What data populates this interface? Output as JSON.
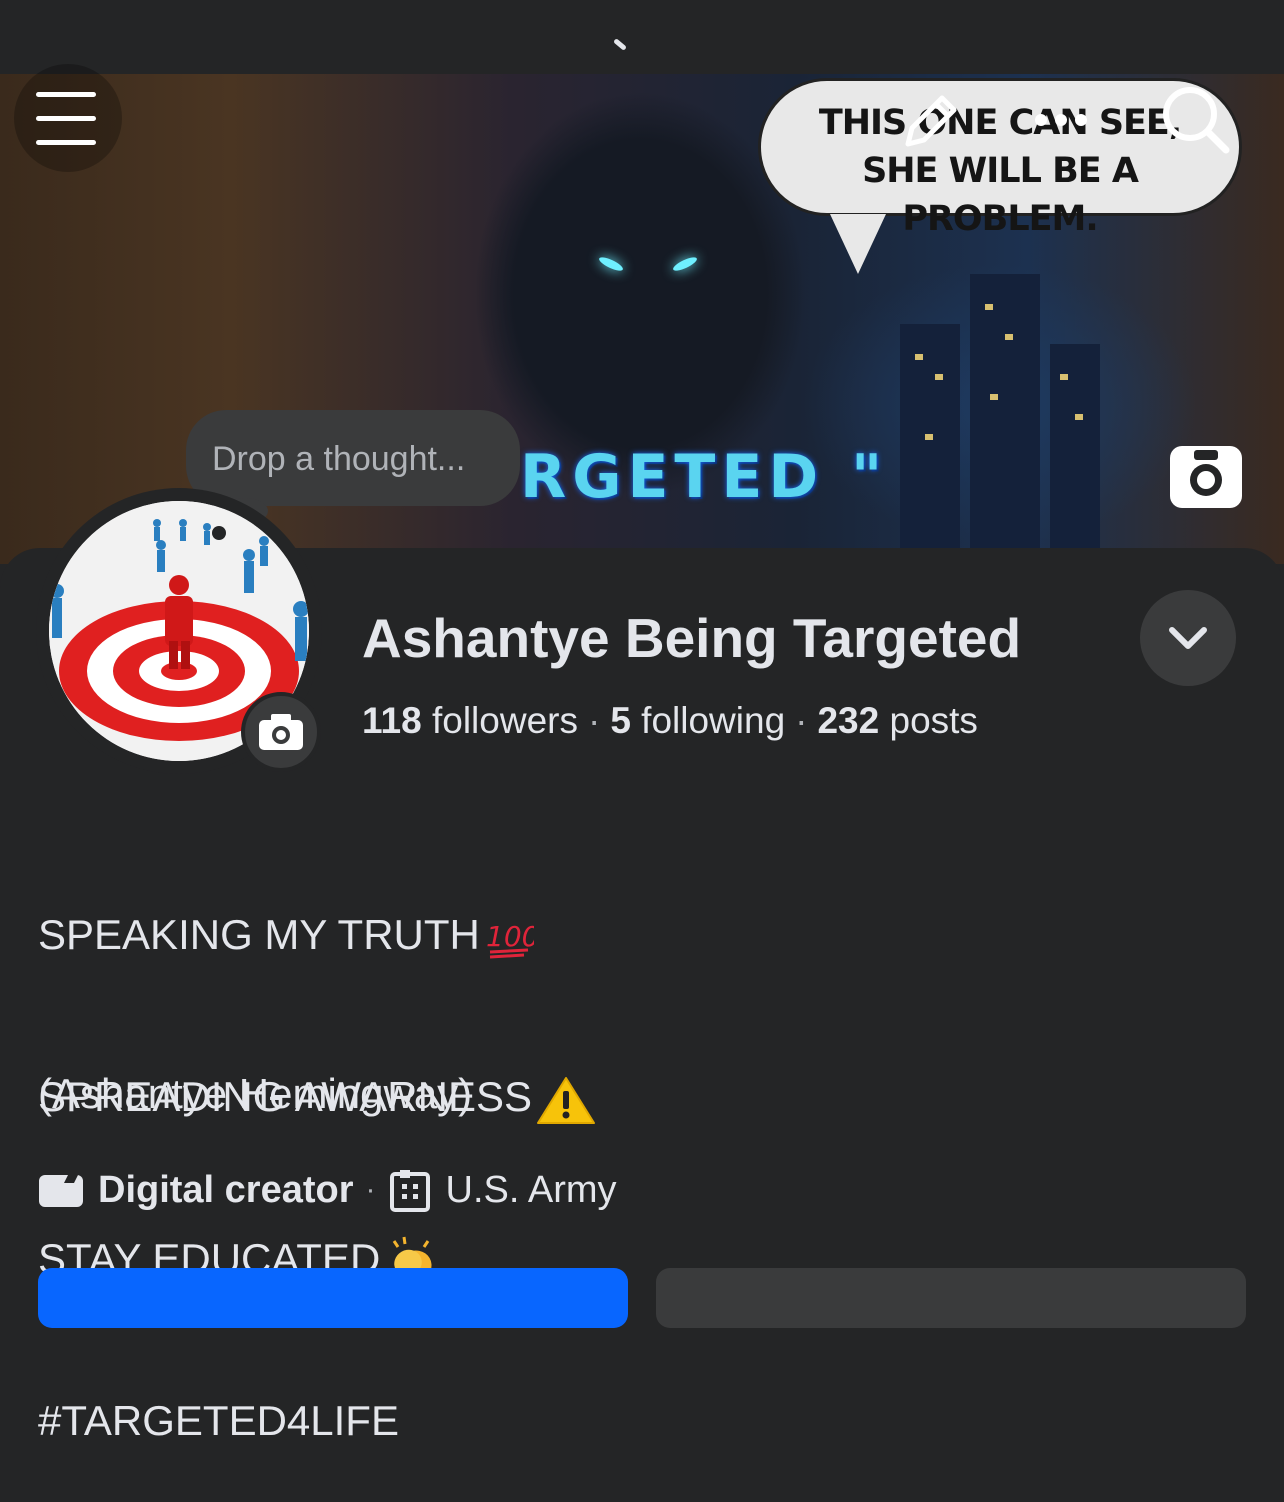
{
  "cover": {
    "speech_line1": "THIS ONE CAN SEE,",
    "speech_line2": "SHE WILL BE A PROBLEM.",
    "title_fragment": "RGETED \""
  },
  "thought": {
    "placeholder": "Drop a thought..."
  },
  "profile": {
    "name": "Ashantye Being Targeted",
    "followers_count": "118",
    "followers_label": "followers",
    "following_count": "5",
    "following_label": "following",
    "posts_count": "232",
    "posts_label": "posts"
  },
  "bio": {
    "line1": "SPEAKING MY TRUTH",
    "line2": "SPREADING AWARNESS",
    "line3": "STAY EDUCATED",
    "line4": "#TARGETED4LIFE",
    "full_name": "(Ashantye Hemingway)"
  },
  "meta": {
    "category": "Digital creator",
    "workplace": "U.S. Army"
  },
  "colors": {
    "accent": "#0866ff",
    "background": "#242526",
    "surface": "#3a3b3c"
  },
  "icons": [
    "menu-icon",
    "edit-pencil-icon",
    "more-icon",
    "search-icon",
    "camera-icon",
    "chevron-down-icon",
    "hundred-emoji",
    "warning-emoji",
    "clap-emoji",
    "video-icon",
    "building-icon"
  ]
}
